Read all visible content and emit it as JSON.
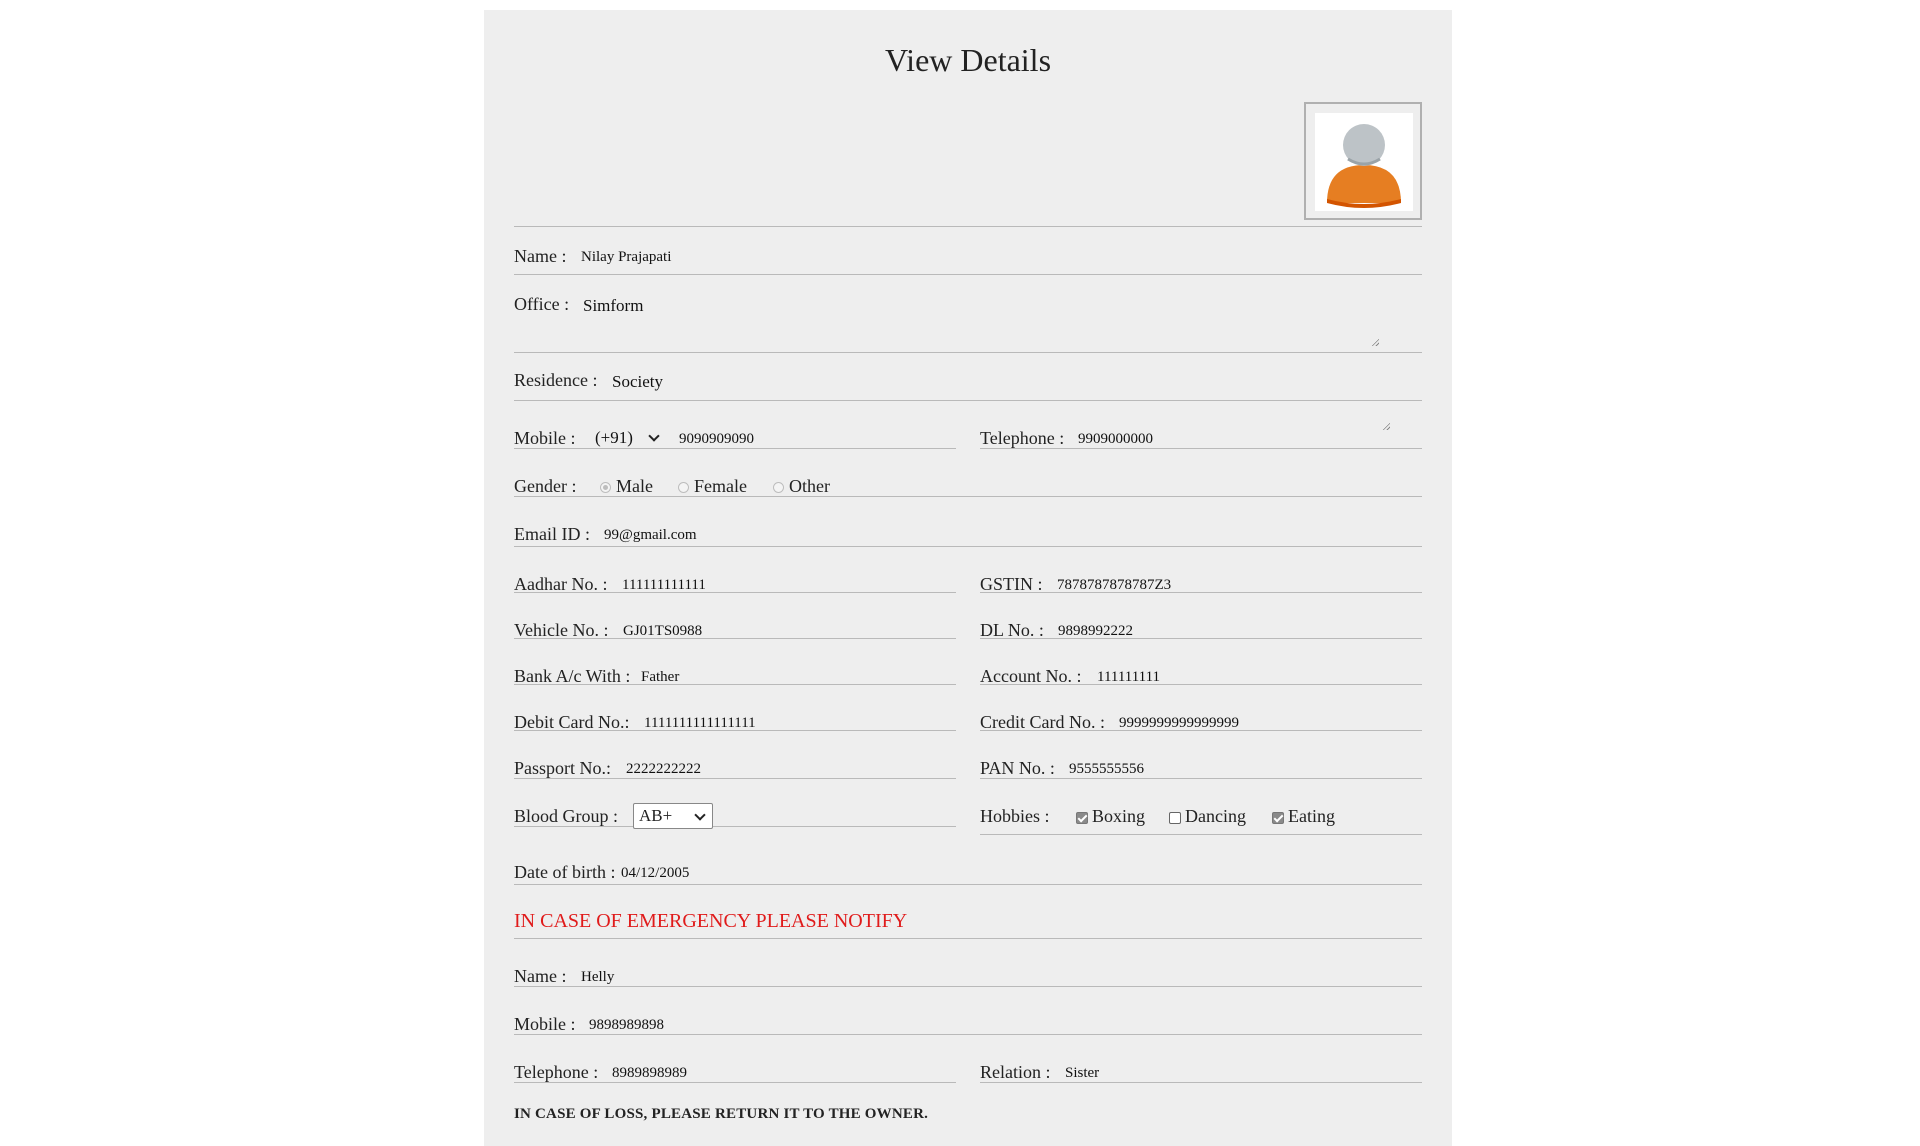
{
  "title": "View Details",
  "name": {
    "label": "Name :",
    "value": "Nilay Prajapati"
  },
  "office": {
    "label": "Office :",
    "value": "Simform"
  },
  "residence": {
    "label": "Residence :",
    "value": "Society"
  },
  "mobile": {
    "label": "Mobile :",
    "code": "(+91)",
    "value": "9090909090"
  },
  "telephone": {
    "label": "Telephone :",
    "value": "9909000000"
  },
  "gender": {
    "label": "Gender :",
    "options": [
      "Male",
      "Female",
      "Other"
    ],
    "selected": "Male"
  },
  "email": {
    "label": "Email ID :",
    "value": "99@gmail.com"
  },
  "aadhar": {
    "label": "Aadhar No. :",
    "value": "111111111111"
  },
  "gstin": {
    "label": "GSTIN :",
    "value": "7878787878787Z3"
  },
  "vehicle": {
    "label": "Vehicle No. :",
    "value": "GJ01TS0988"
  },
  "dl": {
    "label": "DL No. :",
    "value": "9898992222"
  },
  "bank": {
    "label": "Bank A/c With :",
    "value": "Father"
  },
  "account": {
    "label": "Account No. :",
    "value": "111111111"
  },
  "debit": {
    "label": "Debit Card No.:",
    "value": "1111111111111111"
  },
  "credit": {
    "label": "Credit Card No. :",
    "value": "9999999999999999"
  },
  "passport": {
    "label": "Passport No.:",
    "value": "2222222222"
  },
  "pan": {
    "label": "PAN No. :",
    "value": "9555555556"
  },
  "blood": {
    "label": "Blood Group :",
    "value": "AB+"
  },
  "hobbies": {
    "label": "Hobbies :",
    "items": [
      {
        "label": "Boxing",
        "checked": true
      },
      {
        "label": "Dancing",
        "checked": false
      },
      {
        "label": "Eating",
        "checked": true
      }
    ]
  },
  "dob": {
    "label": "Date of birth :",
    "value": "04/12/2005"
  },
  "emergency": {
    "heading": "IN CASE OF EMERGENCY PLEASE NOTIFY",
    "name": {
      "label": "Name :",
      "value": "Helly"
    },
    "mobile": {
      "label": "Mobile :",
      "value": "9898989898"
    },
    "telephone": {
      "label": "Telephone :",
      "value": "8989898989"
    },
    "relation": {
      "label": "Relation :",
      "value": "Sister"
    }
  },
  "footer_note": "IN CASE OF LOSS, PLEASE RETURN IT TO THE OWNER.",
  "colors": {
    "background": "#eeeeee",
    "emergency": "#e01b1b",
    "avatar_body": "#e67e22",
    "avatar_head": "#bdc3c7"
  }
}
